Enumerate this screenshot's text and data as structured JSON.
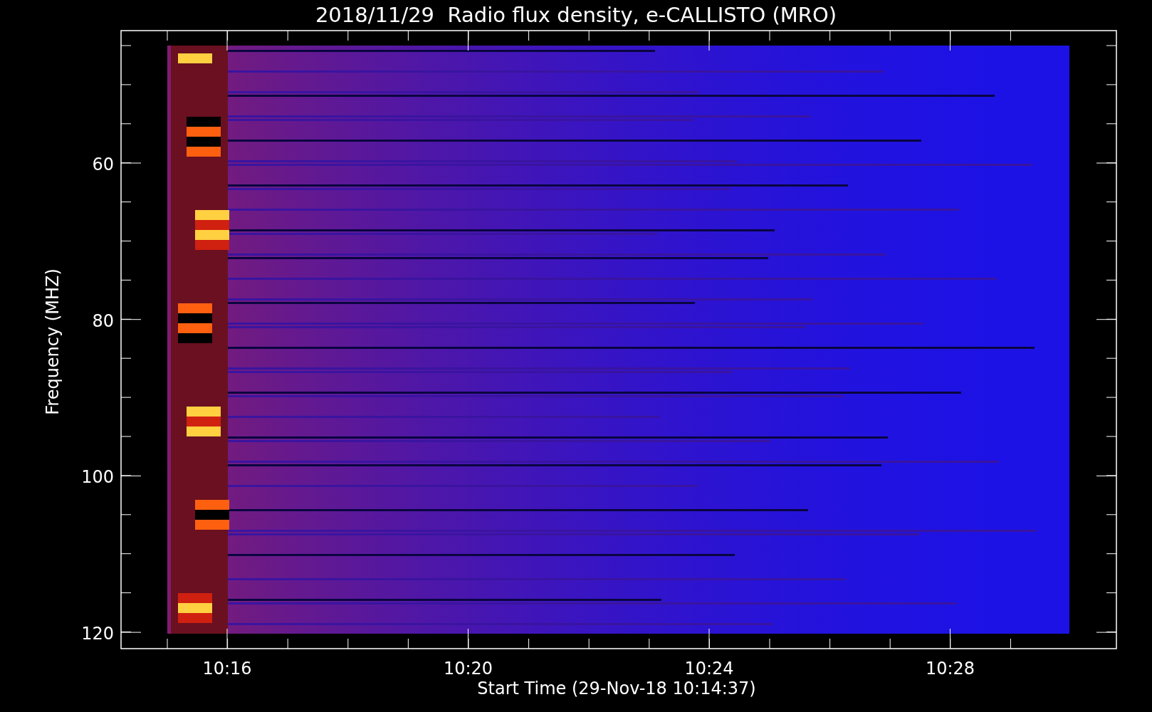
{
  "title": "2018/11/29  Radio flux density, e-CALLISTO (MRO)",
  "ylabel": "Frequency (MHZ)",
  "xlabel": "Start Time (29-Nov-18 10:14:37)",
  "yticks": [
    "60",
    "80",
    "100",
    "120"
  ],
  "xticks": [
    "10:16",
    "10:20",
    "10:24",
    "10:28"
  ]
}
